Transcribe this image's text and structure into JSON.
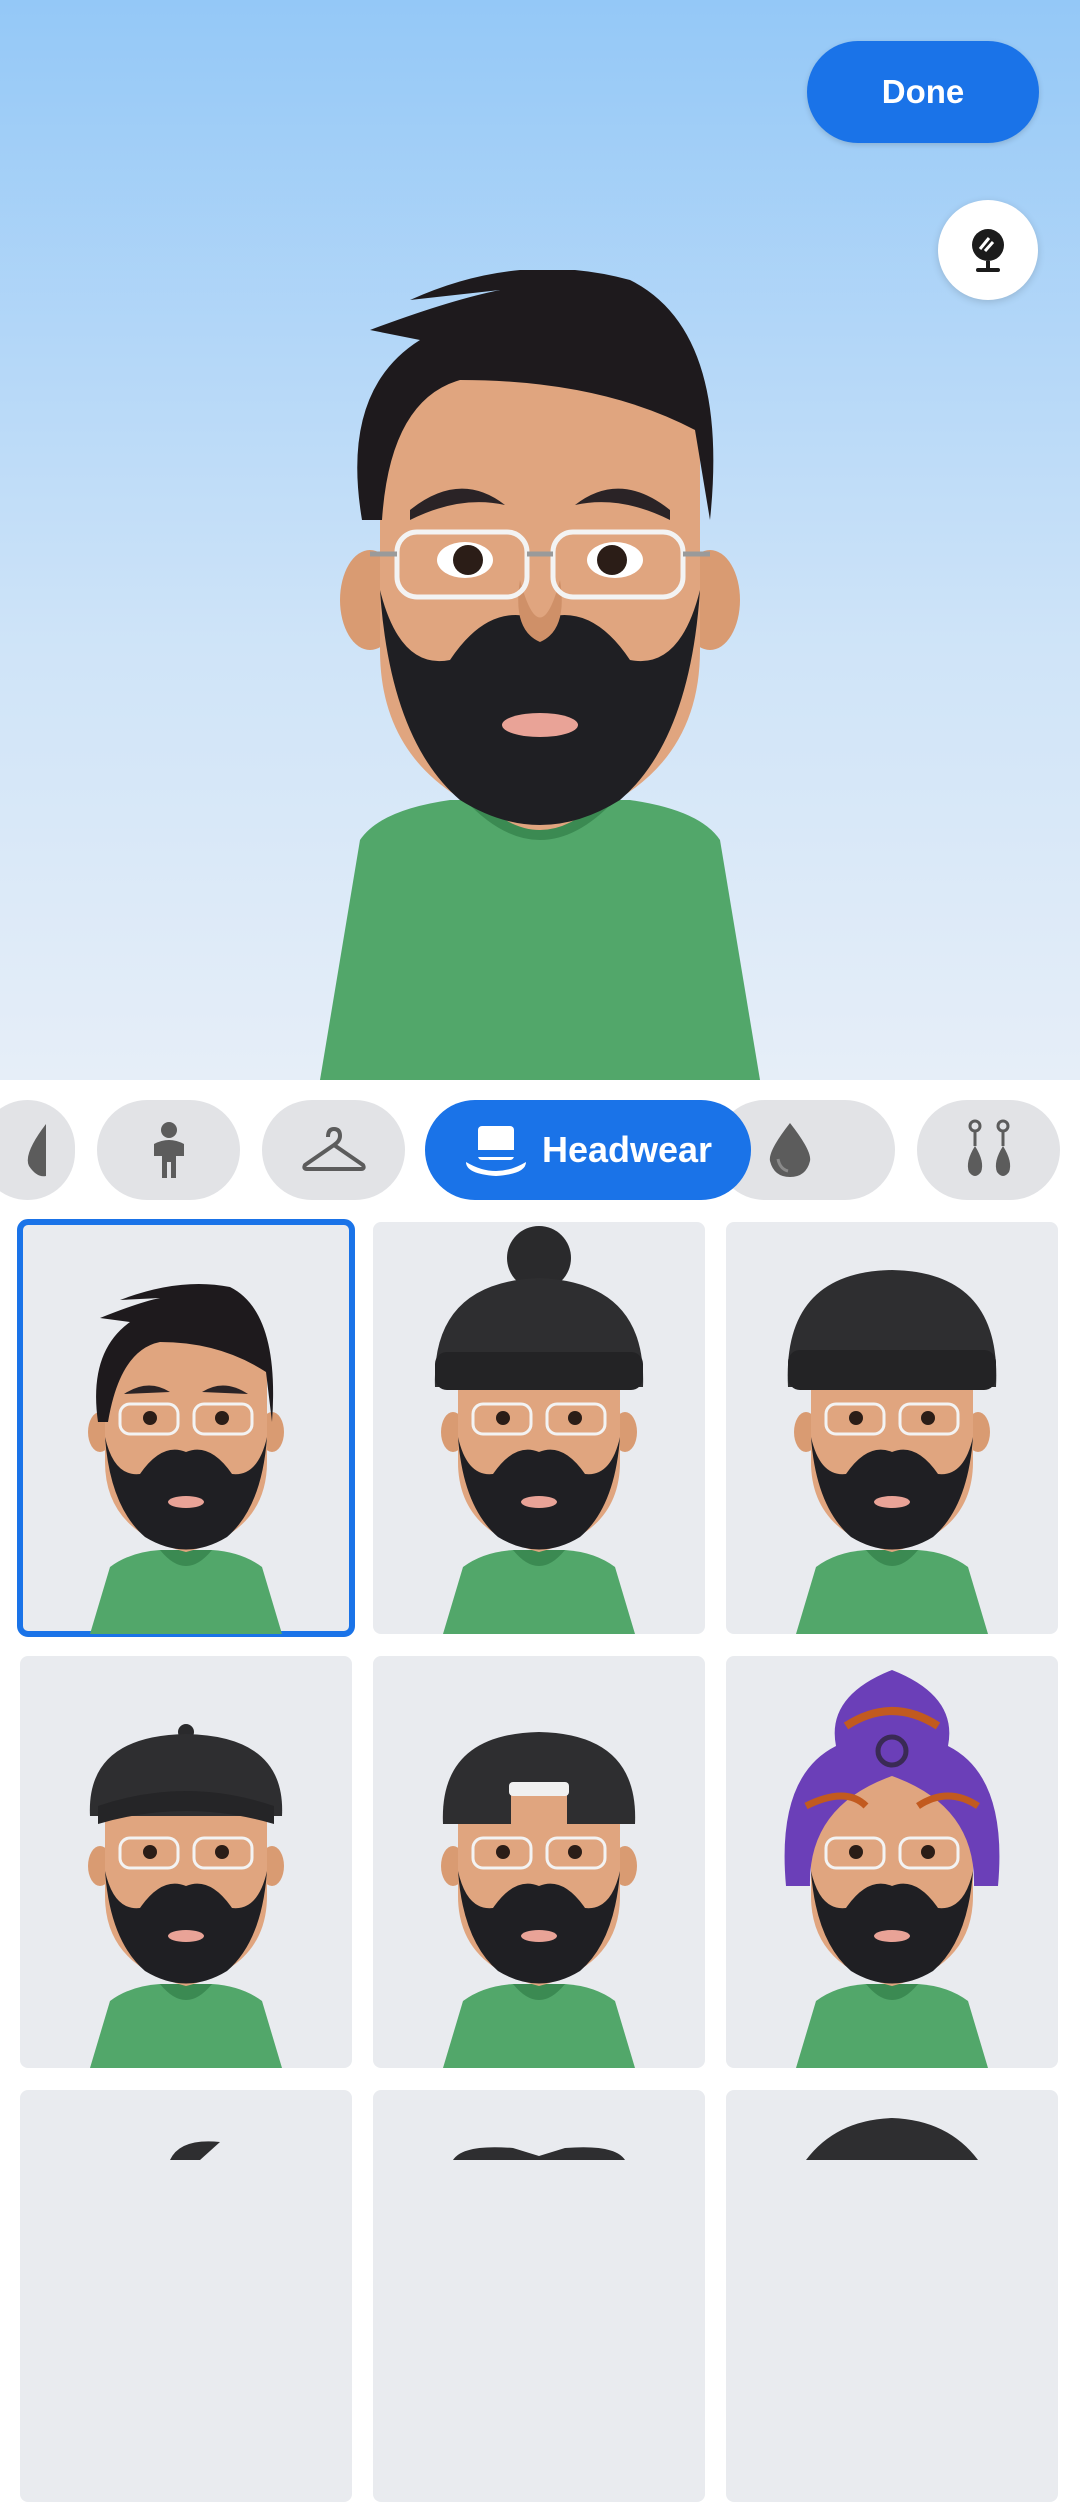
{
  "header": {
    "done_label": "Done",
    "mirror_icon": "mirror-icon"
  },
  "category_tabs": [
    {
      "name": "skin-tone",
      "icon": "drop-half-icon",
      "label": ""
    },
    {
      "name": "body-shape",
      "icon": "body-icon",
      "label": ""
    },
    {
      "name": "outfit",
      "icon": "hanger-icon",
      "label": ""
    },
    {
      "name": "headwear",
      "icon": "top-hat-icon",
      "label": "Headwear",
      "active": true
    },
    {
      "name": "hat-color",
      "icon": "drop-icon",
      "label": ""
    },
    {
      "name": "earrings",
      "icon": "earrings-icon",
      "label": ""
    }
  ],
  "headwear_options": [
    {
      "name": "none",
      "selected": true
    },
    {
      "name": "pompom-beanie"
    },
    {
      "name": "beanie"
    },
    {
      "name": "baseball-cap"
    },
    {
      "name": "backwards-cap"
    },
    {
      "name": "turban"
    }
  ],
  "colors": {
    "accent": "#1a73e8",
    "shirt": "#52a76a",
    "skin": "#e0a57f",
    "beard": "#1f1f23"
  }
}
